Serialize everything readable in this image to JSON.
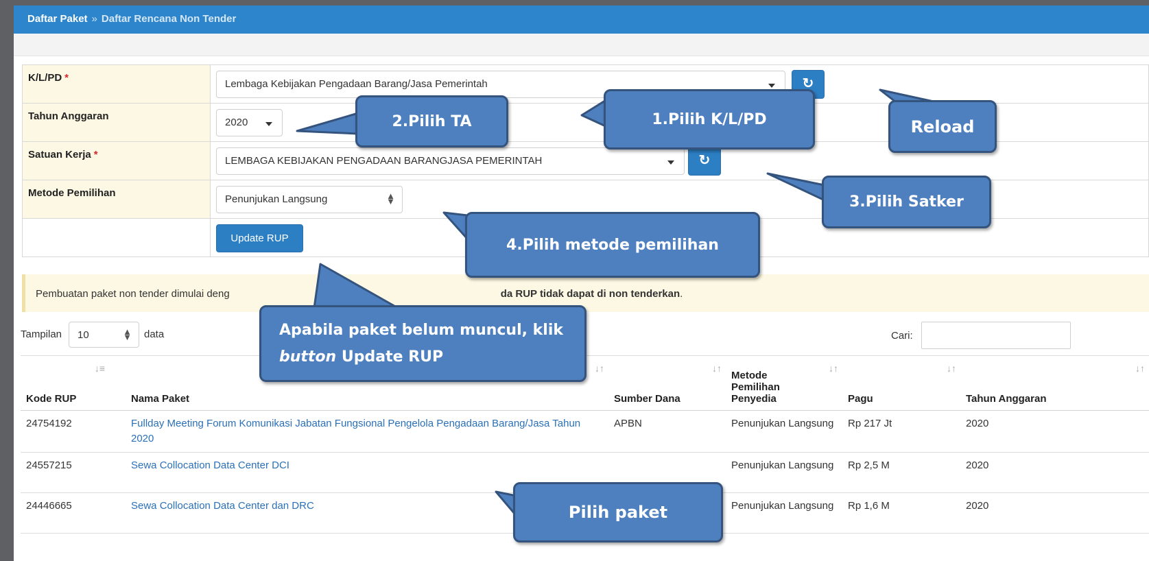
{
  "breadcrumb": {
    "home": "Daftar Paket",
    "separator": "»",
    "current": "Daftar Rencana Non Tender"
  },
  "form": {
    "klpd": {
      "label": "K/L/PD",
      "required": "*",
      "value": "Lembaga Kebijakan Pengadaan Barang/Jasa Pemerintah"
    },
    "tahun": {
      "label": "Tahun Anggaran",
      "value": "2020"
    },
    "satker": {
      "label": "Satuan Kerja",
      "required": "*",
      "value": "LEMBAGA KEBIJAKAN PENGADAAN BARANGJASA PEMERINTAH"
    },
    "metode": {
      "label": "Metode Pemilihan",
      "value": "Penunjukan Langsung"
    },
    "update_label": "Update RUP",
    "reload_icon": "refresh-icon"
  },
  "notice": {
    "text_start": "Pembuatan paket non tender dimulai deng",
    "bold_text": "da RUP tidak dapat di non tenderkan",
    "text_end": "."
  },
  "table_controls": {
    "show_label": "Tampilan",
    "page_length": "10",
    "data_label": "data",
    "search_label": "Cari:"
  },
  "table": {
    "headers": [
      "Kode RUP",
      "Nama Paket",
      "Sumber Dana",
      "Metode Pemilihan Penyedia",
      "Pagu",
      "Tahun Anggaran"
    ],
    "rows": [
      {
        "kode": "24754192",
        "nama": "Fullday Meeting Forum Komunikasi Jabatan Fungsional Pengelola Pengadaan Barang/Jasa Tahun 2020",
        "sumber": "APBN",
        "metode": "Penunjukan Langsung",
        "pagu": "Rp 217 Jt",
        "tahun": "2020"
      },
      {
        "kode": "24557215",
        "nama": "Sewa Collocation Data Center DCI",
        "sumber": "",
        "metode": "Penunjukan Langsung",
        "pagu": "Rp 2,5 M",
        "tahun": "2020"
      },
      {
        "kode": "24446665",
        "nama": "Sewa Collocation Data Center dan DRC",
        "sumber": "",
        "metode": "Penunjukan Langsung",
        "pagu": "Rp 1,6 M",
        "tahun": "2020"
      }
    ]
  },
  "callouts": {
    "pilih_klpd": "1.Pilih K/L/PD",
    "pilih_ta": "2.Pilih TA",
    "reload": "Reload",
    "pilih_satker": "3.Pilih Satker",
    "pilih_metode": "4.Pilih metode pemilihan",
    "update_line1": "Apabila paket belum muncul, klik",
    "update_italic": "button",
    "update_rest": " Update RUP",
    "pilih_paket": "Pilih paket"
  },
  "colors": {
    "topbar": "#2d86cc",
    "label_bg": "#fcf8e3",
    "button": "#2d7fc4",
    "callout": "#4e80c0",
    "link": "#2a70b8",
    "required": "#d9262a"
  }
}
